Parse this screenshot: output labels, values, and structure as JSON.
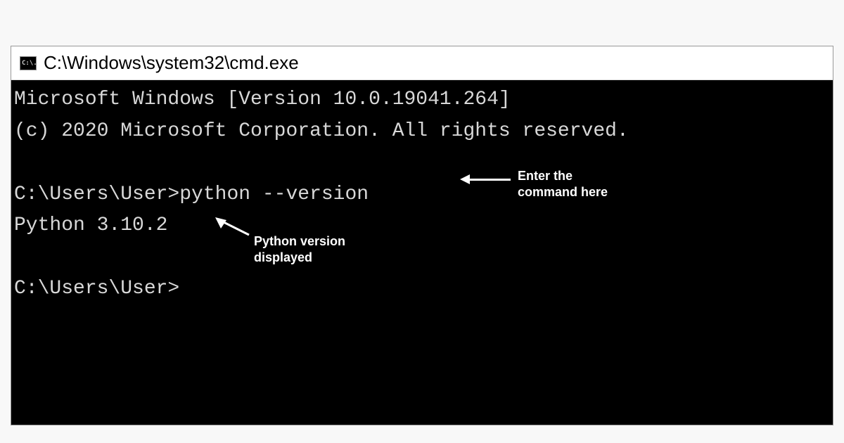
{
  "window": {
    "title": "C:\\Windows\\system32\\cmd.exe",
    "icon_text": "C:\\."
  },
  "terminal": {
    "line1": "Microsoft Windows [Version 10.0.19041.264]",
    "line2": "(c) 2020 Microsoft Corporation. All rights reserved.",
    "prompt1": "C:\\Users\\User>",
    "command": "python --version",
    "output": "Python 3.10.2",
    "prompt2": "C:\\Users\\User>"
  },
  "annotations": {
    "command_hint_line1": "Enter the",
    "command_hint_line2": "command here",
    "output_hint_line1": "Python version",
    "output_hint_line2": "displayed"
  }
}
